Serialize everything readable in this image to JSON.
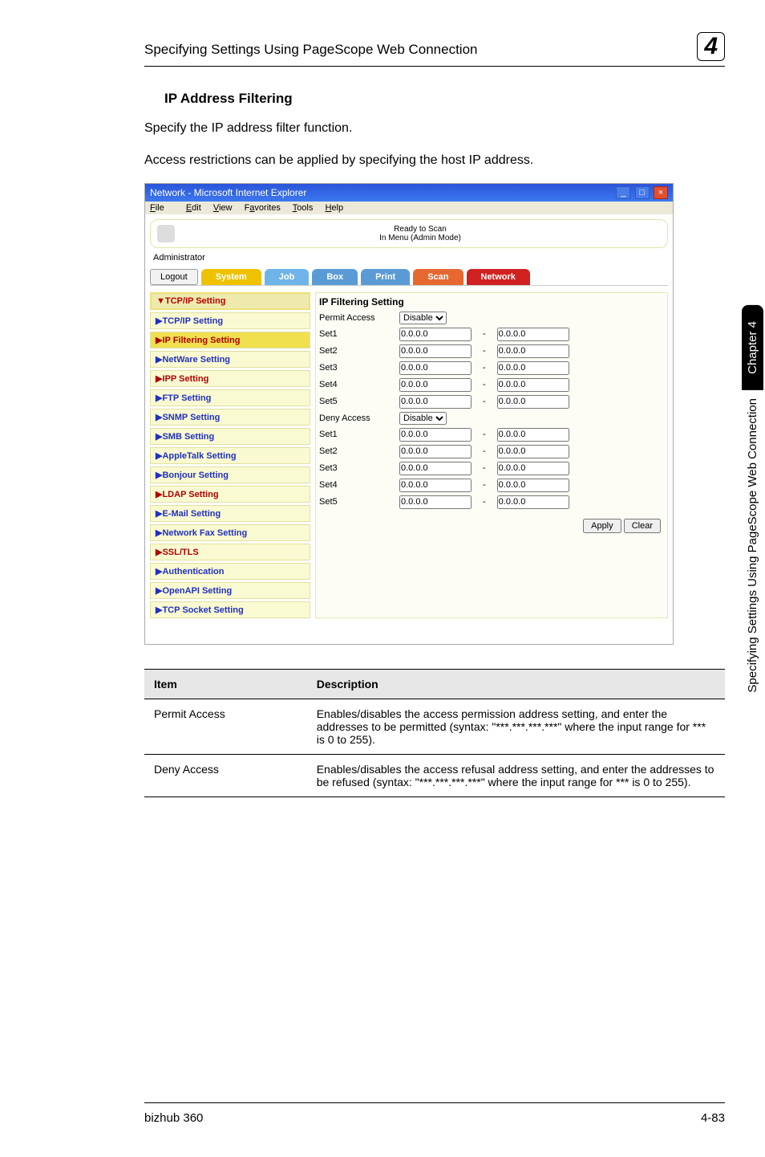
{
  "header": {
    "title": "Specifying Settings Using PageScope Web Connection",
    "chapterNumber": "4"
  },
  "section": {
    "heading": "IP Address Filtering",
    "para1": "Specify the IP address filter function.",
    "para2": "Access restrictions can be applied by specifying the host IP address."
  },
  "ie": {
    "title": "Network - Microsoft Internet Explorer",
    "menu": {
      "file": "File",
      "edit": "Edit",
      "view": "View",
      "favorites": "Favorites",
      "tools": "Tools",
      "help": "Help"
    },
    "bannerLine1": "Ready to Scan",
    "bannerLine2": "In Menu (Admin Mode)",
    "adminLabel": "Administrator",
    "logout": "Logout",
    "tabs": {
      "system": "System",
      "job": "Job",
      "box": "Box",
      "print": "Print",
      "scan": "Scan",
      "network": "Network"
    }
  },
  "navhead": "▼TCP/IP Setting",
  "nav": [
    {
      "label": "TCP/IP Setting",
      "color": "blue"
    },
    {
      "label": "IP Filtering Setting",
      "color": "red",
      "current": true
    },
    {
      "label": "NetWare Setting",
      "color": "blue"
    },
    {
      "label": "IPP Setting",
      "color": "red"
    },
    {
      "label": "FTP Setting",
      "color": "blue"
    },
    {
      "label": "SNMP Setting",
      "color": "blue"
    },
    {
      "label": "SMB Setting",
      "color": "blue"
    },
    {
      "label": "AppleTalk Setting",
      "color": "blue"
    },
    {
      "label": "Bonjour Setting",
      "color": "blue"
    },
    {
      "label": "LDAP Setting",
      "color": "red"
    },
    {
      "label": "E-Mail Setting",
      "color": "blue"
    },
    {
      "label": "Network Fax Setting",
      "color": "blue"
    },
    {
      "label": "SSL/TLS",
      "color": "red"
    },
    {
      "label": "Authentication",
      "color": "blue"
    },
    {
      "label": "OpenAPI Setting",
      "color": "blue"
    },
    {
      "label": "TCP Socket Setting",
      "color": "blue"
    }
  ],
  "form": {
    "title": "IP Filtering Setting",
    "permitLabel": "Permit Access",
    "denyLabel": "Deny Access",
    "enable": "Disable",
    "setLabels": [
      "Set1",
      "Set2",
      "Set3",
      "Set4",
      "Set5"
    ],
    "ipDefault": "0.0.0.0",
    "dash": "-",
    "apply": "Apply",
    "clear": "Clear"
  },
  "table": {
    "h1": "Item",
    "h2": "Description",
    "r1c1": "Permit Access",
    "r1c2": "Enables/disables the access permission address setting, and enter the addresses to be permitted (syntax: \"***.***.***.***\" where the input range for *** is 0 to 255).",
    "r2c1": "Deny Access",
    "r2c2": "Enables/disables the access refusal address setting, and enter the addresses to be refused (syntax: \"***.***.***.***\" where the input range for *** is 0 to 255)."
  },
  "sidebar": {
    "top": "Chapter 4",
    "bottom": "Specifying Settings Using PageScope Web Connection"
  },
  "footer": {
    "left": "bizhub 360",
    "right": "4-83"
  }
}
